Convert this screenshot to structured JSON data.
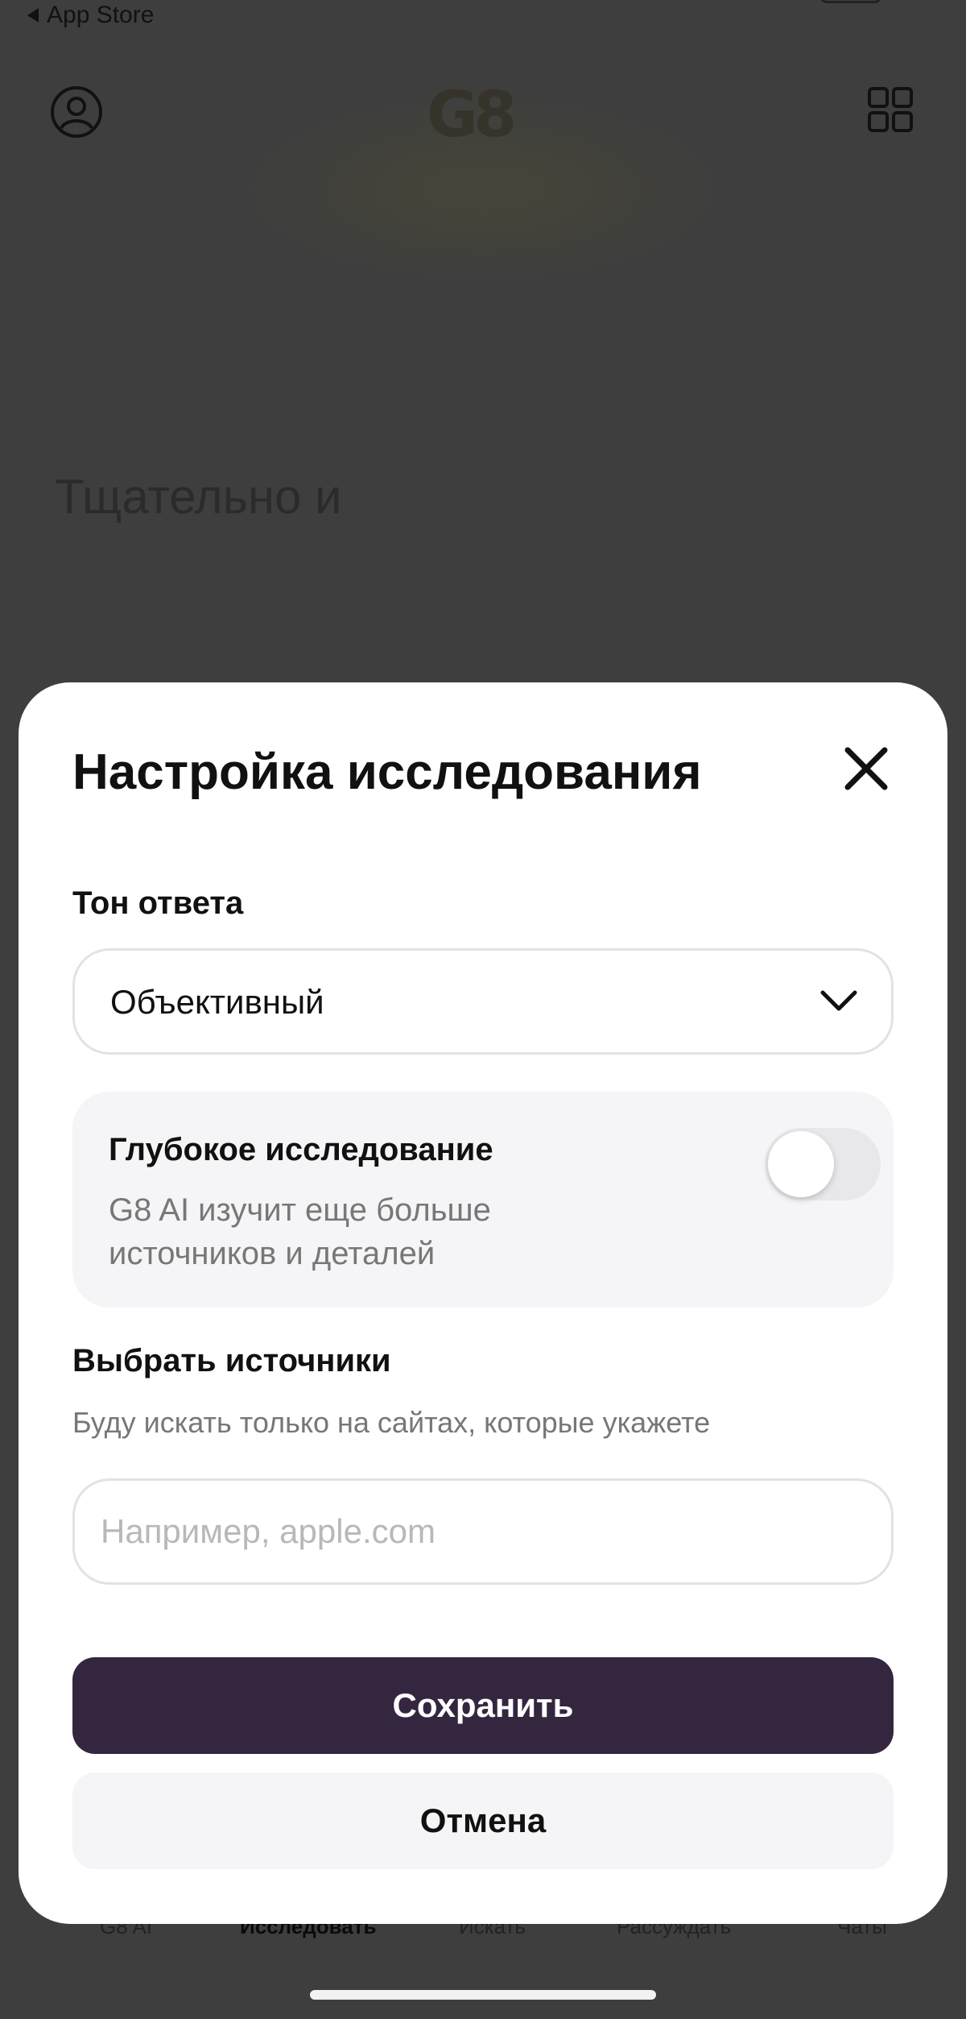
{
  "status_bar": {
    "back_app": "App Store"
  },
  "background": {
    "logo": "G8",
    "title": "Тщательно и",
    "tabs": [
      "G8 AI",
      "Исследовать",
      "Искать",
      "Рассуждать",
      "Чаты"
    ],
    "active_tab": "Исследовать"
  },
  "modal": {
    "title": "Настройка исследования",
    "tone_label": "Тон ответа",
    "tone_value": "Объективный",
    "deep_research": {
      "title": "Глубокое исследование",
      "description": "G8 AI изучит еще больше источников и деталей",
      "enabled": false
    },
    "sources": {
      "title": "Выбрать источники",
      "subtitle": "Буду искать только на сайтах, которые укажете",
      "placeholder": "Например, apple.com",
      "value": ""
    },
    "save_label": "Сохранить",
    "cancel_label": "Отмена"
  },
  "colors": {
    "primary_button": "#352640",
    "overlay": "#3e3e3e"
  }
}
